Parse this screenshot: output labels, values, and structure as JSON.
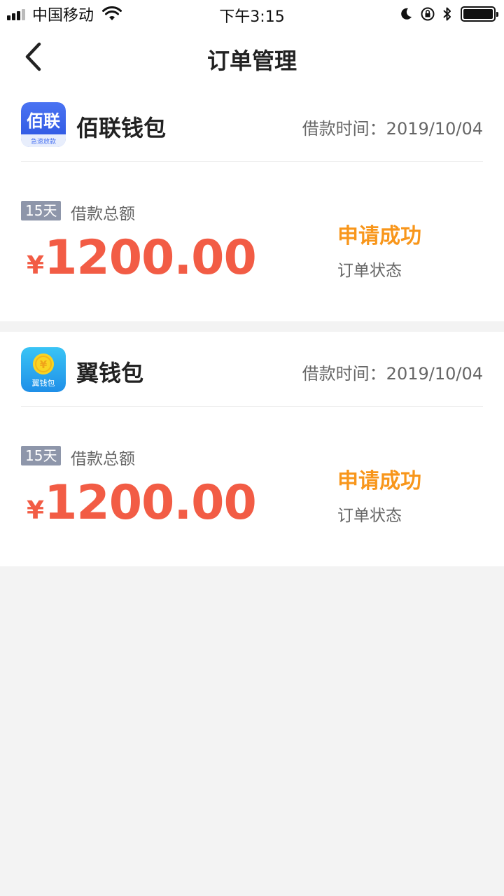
{
  "status_bar": {
    "carrier": "中国移动",
    "time": "下午3:15"
  },
  "nav": {
    "title": "订单管理"
  },
  "orders": [
    {
      "app_name": "佰联钱包",
      "icon_text": "佰联",
      "icon_subtext": "急速放款",
      "loan_time": "借款时间：2019/10/04",
      "term": "15天",
      "amount_label": "借款总额",
      "currency": "¥",
      "amount": "1200.00",
      "status": "申请成功",
      "status_label": "订单状态"
    },
    {
      "app_name": "翼钱包",
      "icon_text": "翼钱包",
      "loan_time": "借款时间：2019/10/04",
      "term": "15天",
      "amount_label": "借款总额",
      "currency": "¥",
      "amount": "1200.00",
      "status": "申请成功",
      "status_label": "订单状态"
    }
  ],
  "colors": {
    "amount": "#f25c45",
    "status": "#f8961b",
    "badge": "#8e96aa",
    "background": "#f3f3f3"
  }
}
